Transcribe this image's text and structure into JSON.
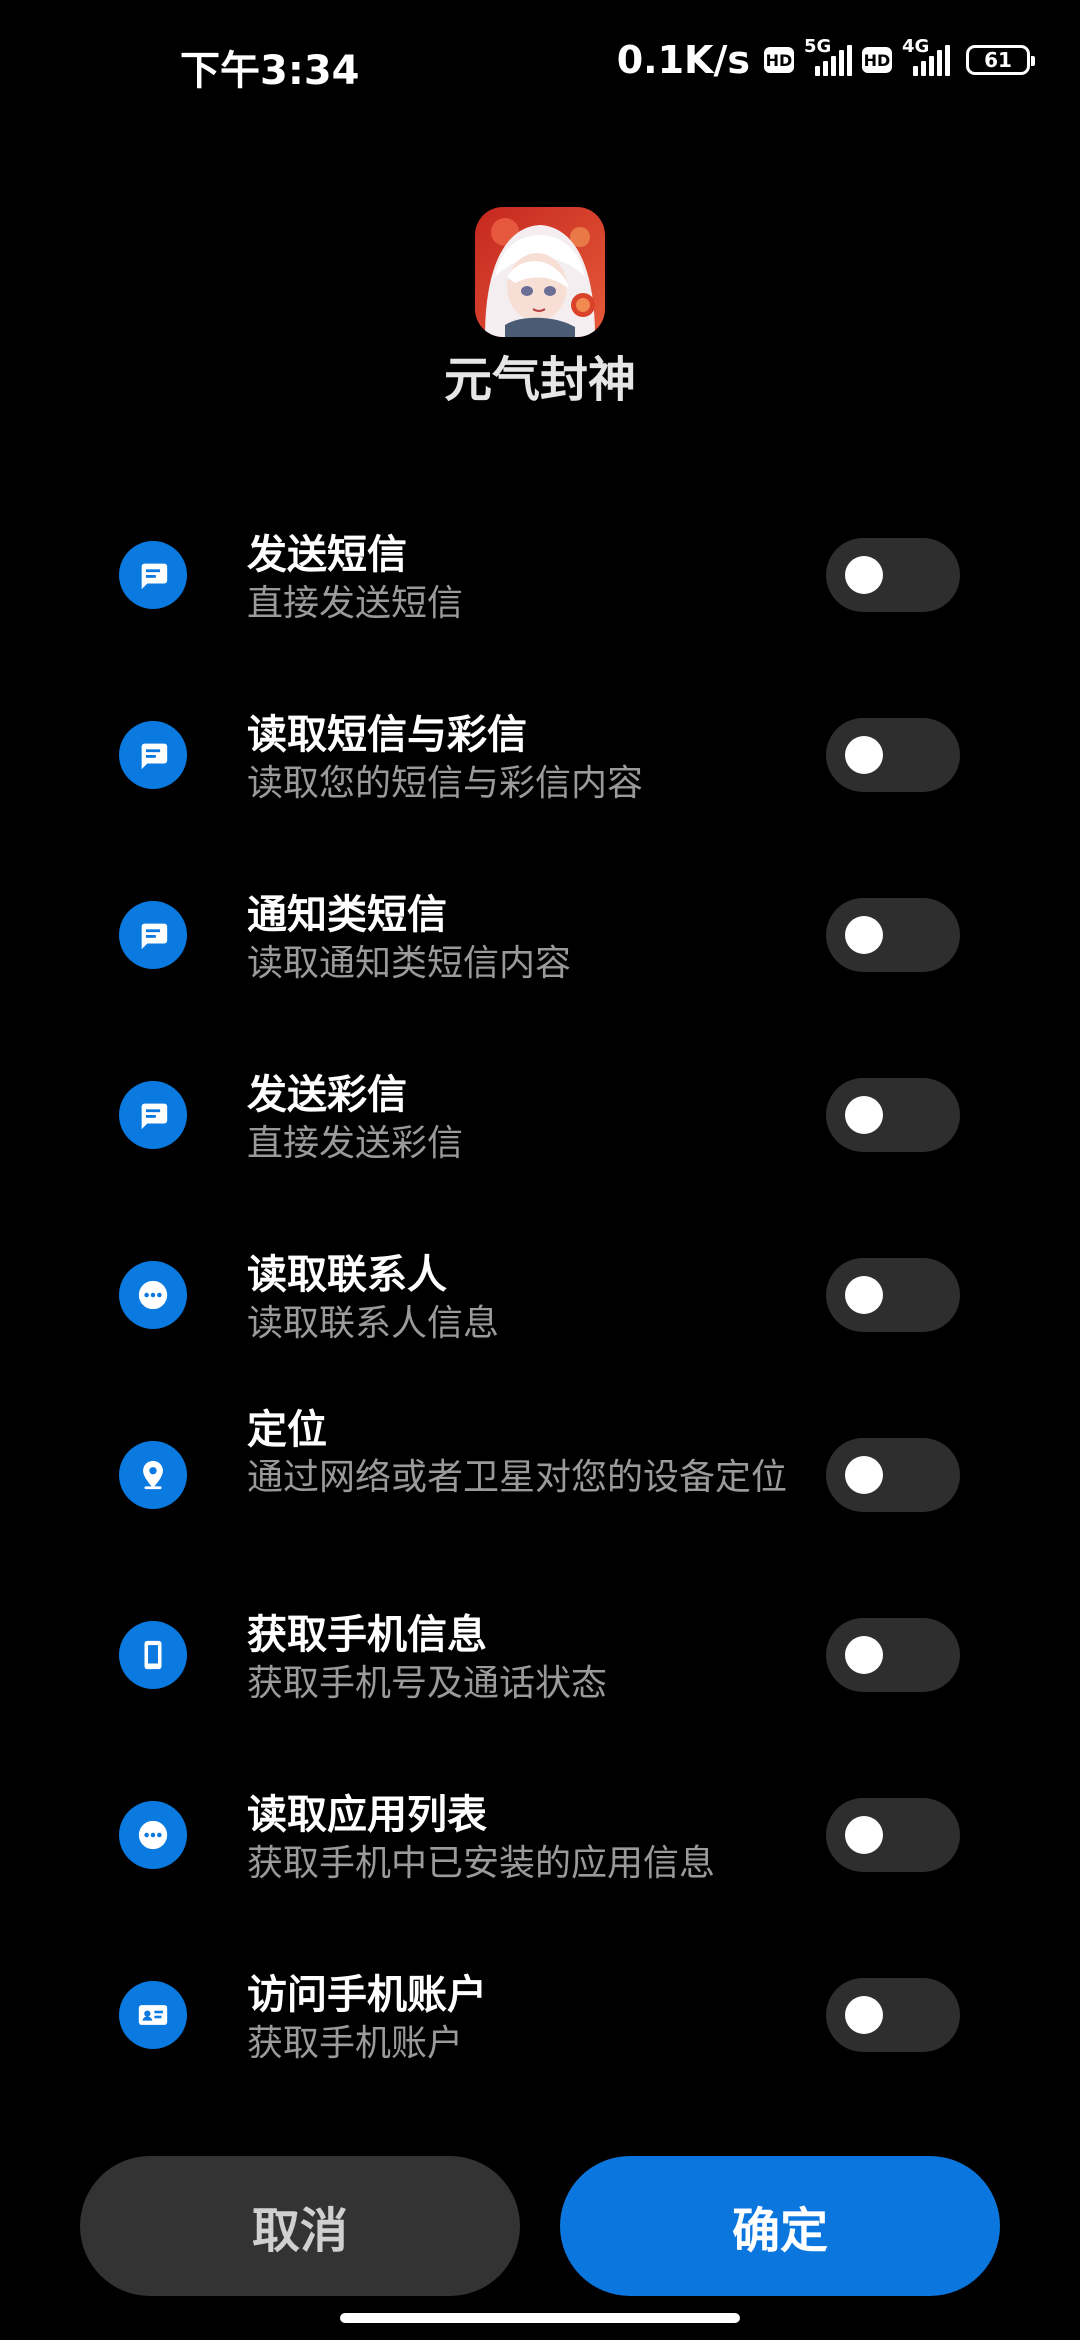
{
  "status_bar": {
    "time": "下午3:34",
    "net_speed": "0.1K/s",
    "hd": "HD",
    "sim1_gen": "5G",
    "sim2_gen": "4G",
    "battery": "61"
  },
  "app": {
    "name": "元气封神"
  },
  "permissions": [
    {
      "title": "发送短信",
      "desc": "直接发送短信",
      "icon": "message-icon",
      "enabled": false
    },
    {
      "title": "读取短信与彩信",
      "desc": "读取您的短信与彩信内容",
      "icon": "message-icon",
      "enabled": false
    },
    {
      "title": "通知类短信",
      "desc": "读取通知类短信内容",
      "icon": "message-icon",
      "enabled": false
    },
    {
      "title": "发送彩信",
      "desc": "直接发送彩信",
      "icon": "message-icon",
      "enabled": false
    },
    {
      "title": "读取联系人",
      "desc": "读取联系人信息",
      "icon": "more-icon",
      "enabled": false
    },
    {
      "title": "定位",
      "desc": "通过网络或者卫星对您的设备定位",
      "icon": "location-icon",
      "enabled": false
    },
    {
      "title": "获取手机信息",
      "desc": "获取手机号及通话状态",
      "icon": "phone-icon",
      "enabled": false
    },
    {
      "title": "读取应用列表",
      "desc": "获取手机中已安装的应用信息",
      "icon": "more-icon",
      "enabled": false
    },
    {
      "title": "访问手机账户",
      "desc": "获取手机账户",
      "icon": "account-card-icon",
      "enabled": false
    }
  ],
  "buttons": {
    "cancel": "取消",
    "ok": "确定"
  },
  "colors": {
    "accent": "#0b76de",
    "background": "#000000",
    "toggle_off": "#2e2e2e"
  }
}
